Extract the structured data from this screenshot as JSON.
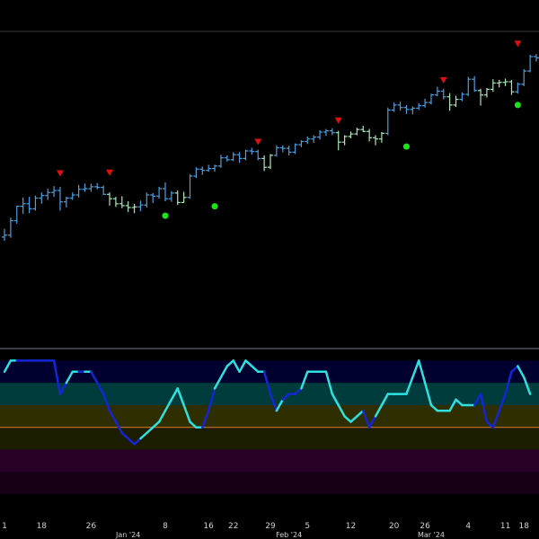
{
  "colors": {
    "background": "#000000",
    "up_bar": "#4a9fe0",
    "down_bar": "#a8e6b8",
    "sell_marker": "#e01010",
    "buy_marker": "#19e619",
    "osc_high": "#1426d2",
    "osc_low": "#2ee0e0",
    "zero_line": "#e07830",
    "band_1": "#00002e",
    "band_2": "#003c3c",
    "band_3": "#2e2e00",
    "band_4": "#1c1c00",
    "band_5": "#280028",
    "band_6": "#160016"
  },
  "chart_data": [
    {
      "type": "ohlc",
      "panel": "price",
      "y_range": [
        0,
        100
      ],
      "x_range": [
        0,
        86
      ],
      "bars": [
        [
          34.6,
          37.2,
          33.4,
          35.2,
          "up"
        ],
        [
          35.2,
          40.8,
          34.4,
          39.8,
          "up"
        ],
        [
          39.8,
          44.6,
          38.8,
          44.4,
          "up"
        ],
        [
          44.4,
          47.2,
          42.0,
          45.2,
          "up"
        ],
        [
          45.2,
          47.4,
          42.2,
          43.6,
          "up"
        ],
        [
          43.6,
          47.8,
          43.0,
          47.0,
          "up"
        ],
        [
          47.0,
          48.8,
          45.2,
          47.8,
          "up"
        ],
        [
          47.8,
          50.0,
          46.4,
          48.8,
          "up"
        ],
        [
          48.8,
          50.8,
          47.4,
          49.4,
          "up"
        ],
        [
          49.4,
          50.6,
          43.0,
          45.8,
          "up"
        ],
        [
          45.8,
          47.4,
          44.0,
          47.0,
          "up"
        ],
        [
          47.0,
          48.8,
          46.4,
          48.0,
          "up"
        ],
        [
          48.0,
          51.2,
          47.2,
          49.8,
          "up"
        ],
        [
          49.8,
          51.6,
          49.0,
          50.0,
          "up"
        ],
        [
          50.0,
          51.6,
          49.0,
          50.6,
          "up"
        ],
        [
          50.6,
          51.8,
          49.8,
          50.4,
          "up"
        ],
        [
          50.4,
          51.0,
          48.0,
          48.2,
          "up"
        ],
        [
          48.2,
          48.8,
          44.6,
          46.8,
          "down"
        ],
        [
          46.8,
          47.4,
          44.2,
          45.2,
          "down"
        ],
        [
          45.2,
          47.6,
          43.8,
          44.6,
          "down"
        ],
        [
          44.6,
          46.0,
          42.6,
          44.0,
          "down"
        ],
        [
          44.0,
          45.2,
          42.2,
          44.2,
          "down"
        ],
        [
          44.2,
          46.2,
          42.8,
          44.8,
          "up"
        ],
        [
          44.8,
          48.8,
          44.0,
          48.0,
          "up"
        ],
        [
          48.0,
          48.6,
          45.4,
          47.6,
          "up"
        ],
        [
          47.6,
          50.6,
          46.8,
          50.0,
          "up"
        ],
        [
          50.0,
          52.0,
          46.0,
          46.8,
          "up"
        ],
        [
          46.8,
          49.2,
          45.8,
          48.6,
          "up"
        ],
        [
          48.6,
          49.4,
          44.8,
          45.6,
          "down"
        ],
        [
          45.6,
          49.0,
          45.4,
          47.2,
          "down"
        ],
        [
          47.2,
          54.6,
          46.8,
          54.0,
          "up"
        ],
        [
          54.0,
          56.8,
          53.4,
          56.2,
          "up"
        ],
        [
          56.2,
          57.0,
          54.4,
          55.8,
          "up"
        ],
        [
          55.8,
          57.6,
          55.4,
          56.4,
          "up"
        ],
        [
          56.4,
          57.6,
          55.4,
          57.2,
          "up"
        ],
        [
          57.2,
          60.8,
          56.6,
          59.8,
          "up"
        ],
        [
          59.8,
          60.6,
          58.6,
          59.2,
          "up"
        ],
        [
          59.2,
          61.6,
          58.8,
          60.8,
          "up"
        ],
        [
          60.8,
          61.6,
          58.2,
          59.6,
          "up"
        ],
        [
          59.6,
          62.4,
          59.0,
          62.0,
          "up"
        ],
        [
          62.0,
          63.0,
          60.8,
          61.8,
          "up"
        ],
        [
          61.8,
          62.4,
          59.0,
          59.6,
          "up"
        ],
        [
          59.6,
          60.6,
          55.6,
          56.8,
          "down"
        ],
        [
          56.8,
          61.0,
          56.2,
          60.6,
          "down"
        ],
        [
          60.6,
          63.8,
          60.2,
          63.0,
          "up"
        ],
        [
          63.0,
          63.8,
          61.6,
          62.8,
          "up"
        ],
        [
          62.8,
          63.6,
          60.6,
          61.6,
          "up"
        ],
        [
          61.6,
          64.4,
          61.0,
          64.0,
          "up"
        ],
        [
          64.0,
          65.4,
          63.2,
          65.0,
          "up"
        ],
        [
          65.0,
          66.6,
          64.2,
          65.8,
          "up"
        ],
        [
          65.8,
          67.0,
          64.6,
          66.4,
          "up"
        ],
        [
          66.4,
          68.6,
          65.6,
          68.0,
          "up"
        ],
        [
          68.0,
          69.0,
          66.8,
          68.4,
          "up"
        ],
        [
          68.4,
          69.2,
          67.0,
          67.8,
          "up"
        ],
        [
          67.8,
          68.4,
          62.2,
          64.8,
          "down"
        ],
        [
          64.8,
          67.0,
          63.8,
          66.6,
          "down"
        ],
        [
          66.6,
          68.2,
          66.0,
          67.4,
          "down"
        ],
        [
          67.4,
          69.4,
          67.0,
          68.8,
          "down"
        ],
        [
          68.8,
          70.0,
          68.0,
          68.2,
          "down"
        ],
        [
          68.2,
          69.0,
          65.0,
          66.2,
          "down"
        ],
        [
          66.2,
          67.0,
          63.8,
          65.8,
          "down"
        ],
        [
          65.8,
          68.0,
          64.6,
          67.6,
          "down"
        ],
        [
          67.6,
          75.8,
          67.0,
          75.0,
          "up"
        ],
        [
          75.0,
          77.4,
          74.4,
          76.6,
          "up"
        ],
        [
          76.6,
          77.6,
          74.8,
          75.8,
          "up"
        ],
        [
          75.8,
          76.6,
          73.8,
          75.2,
          "up"
        ],
        [
          75.2,
          76.2,
          73.6,
          75.6,
          "up"
        ],
        [
          75.6,
          77.2,
          75.0,
          76.4,
          "up"
        ],
        [
          76.4,
          78.6,
          75.8,
          77.4,
          "up"
        ],
        [
          77.4,
          80.2,
          76.8,
          79.8,
          "up"
        ],
        [
          79.8,
          82.4,
          79.4,
          81.0,
          "up"
        ],
        [
          81.0,
          81.8,
          78.4,
          79.2,
          "up"
        ],
        [
          79.2,
          80.4,
          74.8,
          76.6,
          "down"
        ],
        [
          76.6,
          79.6,
          76.0,
          78.4,
          "down"
        ],
        [
          78.4,
          80.6,
          77.8,
          80.0,
          "up"
        ],
        [
          80.0,
          85.6,
          79.4,
          84.8,
          "up"
        ],
        [
          84.8,
          85.8,
          80.8,
          81.2,
          "up"
        ],
        [
          81.2,
          81.8,
          76.4,
          79.8,
          "down"
        ],
        [
          79.8,
          82.0,
          79.0,
          81.6,
          "down"
        ],
        [
          81.6,
          84.8,
          80.8,
          83.6,
          "down"
        ],
        [
          83.6,
          84.6,
          82.2,
          83.8,
          "down"
        ],
        [
          83.8,
          85.0,
          82.6,
          84.0,
          "down"
        ],
        [
          84.0,
          84.6,
          79.8,
          80.8,
          "down"
        ],
        [
          80.8,
          83.8,
          80.2,
          83.2,
          "up"
        ],
        [
          83.2,
          88.0,
          82.6,
          87.4,
          "up"
        ],
        [
          87.4,
          92.6,
          87.0,
          92.0,
          "up"
        ],
        [
          92.0,
          92.8,
          90.4,
          91.6,
          "up"
        ]
      ],
      "sell_signals": [
        {
          "index": 9,
          "value": 55.0
        },
        {
          "index": 17,
          "value": 55.2
        },
        {
          "index": 41,
          "value": 65.0
        },
        {
          "index": 54,
          "value": 71.8
        },
        {
          "index": 71,
          "value": 84.6
        },
        {
          "index": 83,
          "value": 96.2
        }
      ],
      "buy_signals": [
        {
          "index": 26,
          "value": 41.4
        },
        {
          "index": 34,
          "value": 44.4
        },
        {
          "index": 65,
          "value": 63.4
        },
        {
          "index": 83,
          "value": 76.6
        }
      ]
    },
    {
      "type": "line",
      "panel": "oscillator",
      "y_range": [
        -40,
        110
      ],
      "bands": [
        {
          "from": 80,
          "to": 100,
          "color_key": "band_1"
        },
        {
          "from": 60,
          "to": 80,
          "color_key": "band_2"
        },
        {
          "from": 40,
          "to": 60,
          "color_key": "band_3"
        },
        {
          "from": 20,
          "to": 40,
          "color_key": "band_4"
        },
        {
          "from": 0,
          "to": 20,
          "color_key": "band_5"
        },
        {
          "from": -20,
          "to": 0,
          "color_key": "band_6"
        }
      ],
      "reference_line": 40,
      "values": [
        90,
        100,
        100,
        100,
        100,
        100,
        100,
        100,
        100,
        70,
        80,
        90,
        90,
        90,
        90,
        80,
        70,
        55,
        45,
        35,
        30,
        25,
        30,
        35,
        40,
        45,
        55,
        65,
        75,
        60,
        45,
        40,
        40,
        55,
        75,
        85,
        95,
        100,
        90,
        100,
        95,
        90,
        90,
        70,
        55,
        65,
        70,
        70,
        75,
        90,
        90,
        90,
        90,
        70,
        60,
        50,
        45,
        50,
        55,
        40,
        50,
        60,
        70,
        70,
        70,
        70,
        85,
        100,
        80,
        60,
        55,
        55,
        55,
        65,
        60,
        60,
        60,
        70,
        45,
        40,
        55,
        70,
        90,
        95,
        85,
        70
      ],
      "value_colors": [
        "osc_low",
        "osc_low",
        "osc_high",
        "osc_high",
        "osc_high",
        "osc_high",
        "osc_high",
        "osc_high",
        "osc_high",
        "osc_high",
        "osc_low",
        "osc_low",
        "osc_high",
        "osc_low",
        "osc_high",
        "osc_high",
        "osc_high",
        "osc_high",
        "osc_high",
        "osc_high",
        "osc_high",
        "osc_high",
        "osc_low",
        "osc_low",
        "osc_low",
        "osc_low",
        "osc_low",
        "osc_low",
        "osc_low",
        "osc_low",
        "osc_low",
        "osc_low",
        "osc_high",
        "osc_high",
        "osc_low",
        "osc_low",
        "osc_low",
        "osc_low",
        "osc_low",
        "osc_low",
        "osc_low",
        "osc_low",
        "osc_high",
        "osc_high",
        "osc_low",
        "osc_high",
        "osc_high",
        "osc_high",
        "osc_low",
        "osc_low",
        "osc_low",
        "osc_low",
        "osc_low",
        "osc_low",
        "osc_low",
        "osc_low",
        "osc_low",
        "osc_low",
        "osc_high",
        "osc_high",
        "osc_low",
        "osc_low",
        "osc_low",
        "osc_low",
        "osc_low",
        "osc_low",
        "osc_low",
        "osc_low",
        "osc_low",
        "osc_low",
        "osc_low",
        "osc_low",
        "osc_low",
        "osc_low",
        "osc_low",
        "osc_low",
        "osc_high",
        "osc_high",
        "osc_high",
        "osc_high",
        "osc_high",
        "osc_high",
        "osc_high",
        "osc_low",
        "osc_low",
        "osc_low"
      ]
    }
  ],
  "x_axis": {
    "day_ticks": [
      {
        "index": 0,
        "label": "1"
      },
      {
        "index": 6,
        "label": "18"
      },
      {
        "index": 14,
        "label": "26"
      },
      {
        "index": 26,
        "label": "8"
      },
      {
        "index": 33,
        "label": "16"
      },
      {
        "index": 37,
        "label": "22"
      },
      {
        "index": 43,
        "label": "29"
      },
      {
        "index": 49,
        "label": "5"
      },
      {
        "index": 56,
        "label": "12"
      },
      {
        "index": 63,
        "label": "20"
      },
      {
        "index": 68,
        "label": "26"
      },
      {
        "index": 75,
        "label": "4"
      },
      {
        "index": 81,
        "label": "11"
      },
      {
        "index": 84,
        "label": "18"
      }
    ],
    "month_ticks": [
      {
        "index": 20,
        "label": "Jan '24"
      },
      {
        "index": 46,
        "label": "Feb '24"
      },
      {
        "index": 69,
        "label": "Mar '24"
      }
    ]
  }
}
